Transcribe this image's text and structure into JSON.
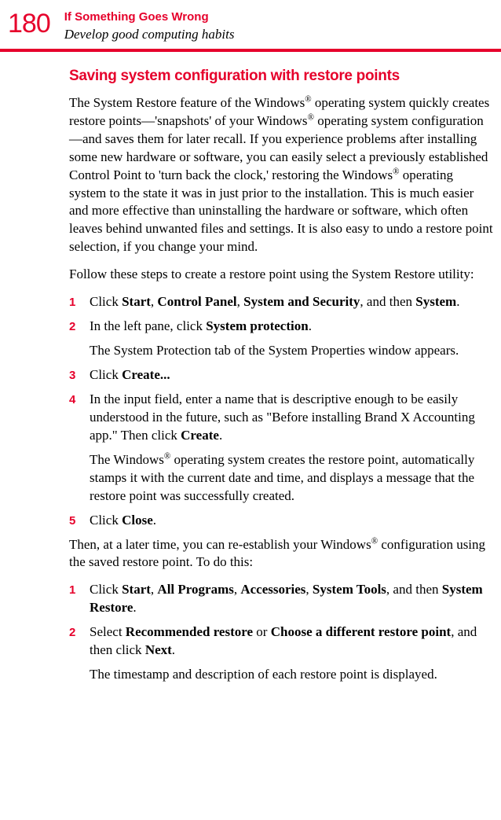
{
  "page_number": "180",
  "chapter_title": "If Something Goes Wrong",
  "section_subtitle": "Develop good computing habits",
  "section_heading": "Saving system configuration with restore points",
  "intro_para_html": "The System Restore feature of the Windows<sup>®</sup> operating system quickly creates restore points—'snapshots' of your Windows<sup>®</sup> operating system configuration—and saves them for later recall. If you experience problems after installing some new hardware or software, you can easily select a previously established Control Point to 'turn back the clock,' restoring the Windows<sup>®</sup> operating system to the state it was in just prior to the installation. This is much easier and more effective than uninstalling the hardware or software, which often leaves behind unwanted files and settings. It is also easy to undo a restore point selection, if you change your mind.",
  "follow_para": "Follow these steps to create a restore point using the System Restore utility:",
  "steps_a": [
    {
      "num": "1",
      "html": "Click <span class='b'>Start</span>, <span class='b'>Control Panel</span>, <span class='b'>System and Security</span>, and then <span class='b'>System</span>."
    },
    {
      "num": "2",
      "html": "In the left pane, click <span class='b'>System protection</span>.",
      "after_html": "The System Protection tab of the System Properties window appears."
    },
    {
      "num": "3",
      "html": "Click <span class='b'>Create...</span>"
    },
    {
      "num": "4",
      "html": "In the input field, enter a name that is descriptive enough to be easily understood in the future, such as \"Before installing Brand X Accounting app.\" Then click <span class='b'>Create</span>.",
      "after_html": "The Windows<sup>®</sup> operating system creates the restore point, automatically stamps it with the current date and time, and displays a message that the restore point was successfully created."
    },
    {
      "num": "5",
      "html": "Click <span class='b'>Close</span>."
    }
  ],
  "then_para_html": "Then, at a later time, you can re-establish your Windows<sup>®</sup> configuration using the saved restore point. To do this:",
  "steps_b": [
    {
      "num": "1",
      "html": "Click <span class='b'>Start</span>, <span class='b'>All Programs</span>, <span class='b'>Accessories</span>, <span class='b'>System Tools</span>, and then <span class='b'>System Restore</span>."
    },
    {
      "num": "2",
      "html": "Select <span class='b'>Recommended restore</span> or <span class='b'>Choose a different restore point</span>, and then click <span class='b'>Next</span>.",
      "after_html": "The timestamp and description of each restore point is displayed."
    }
  ]
}
